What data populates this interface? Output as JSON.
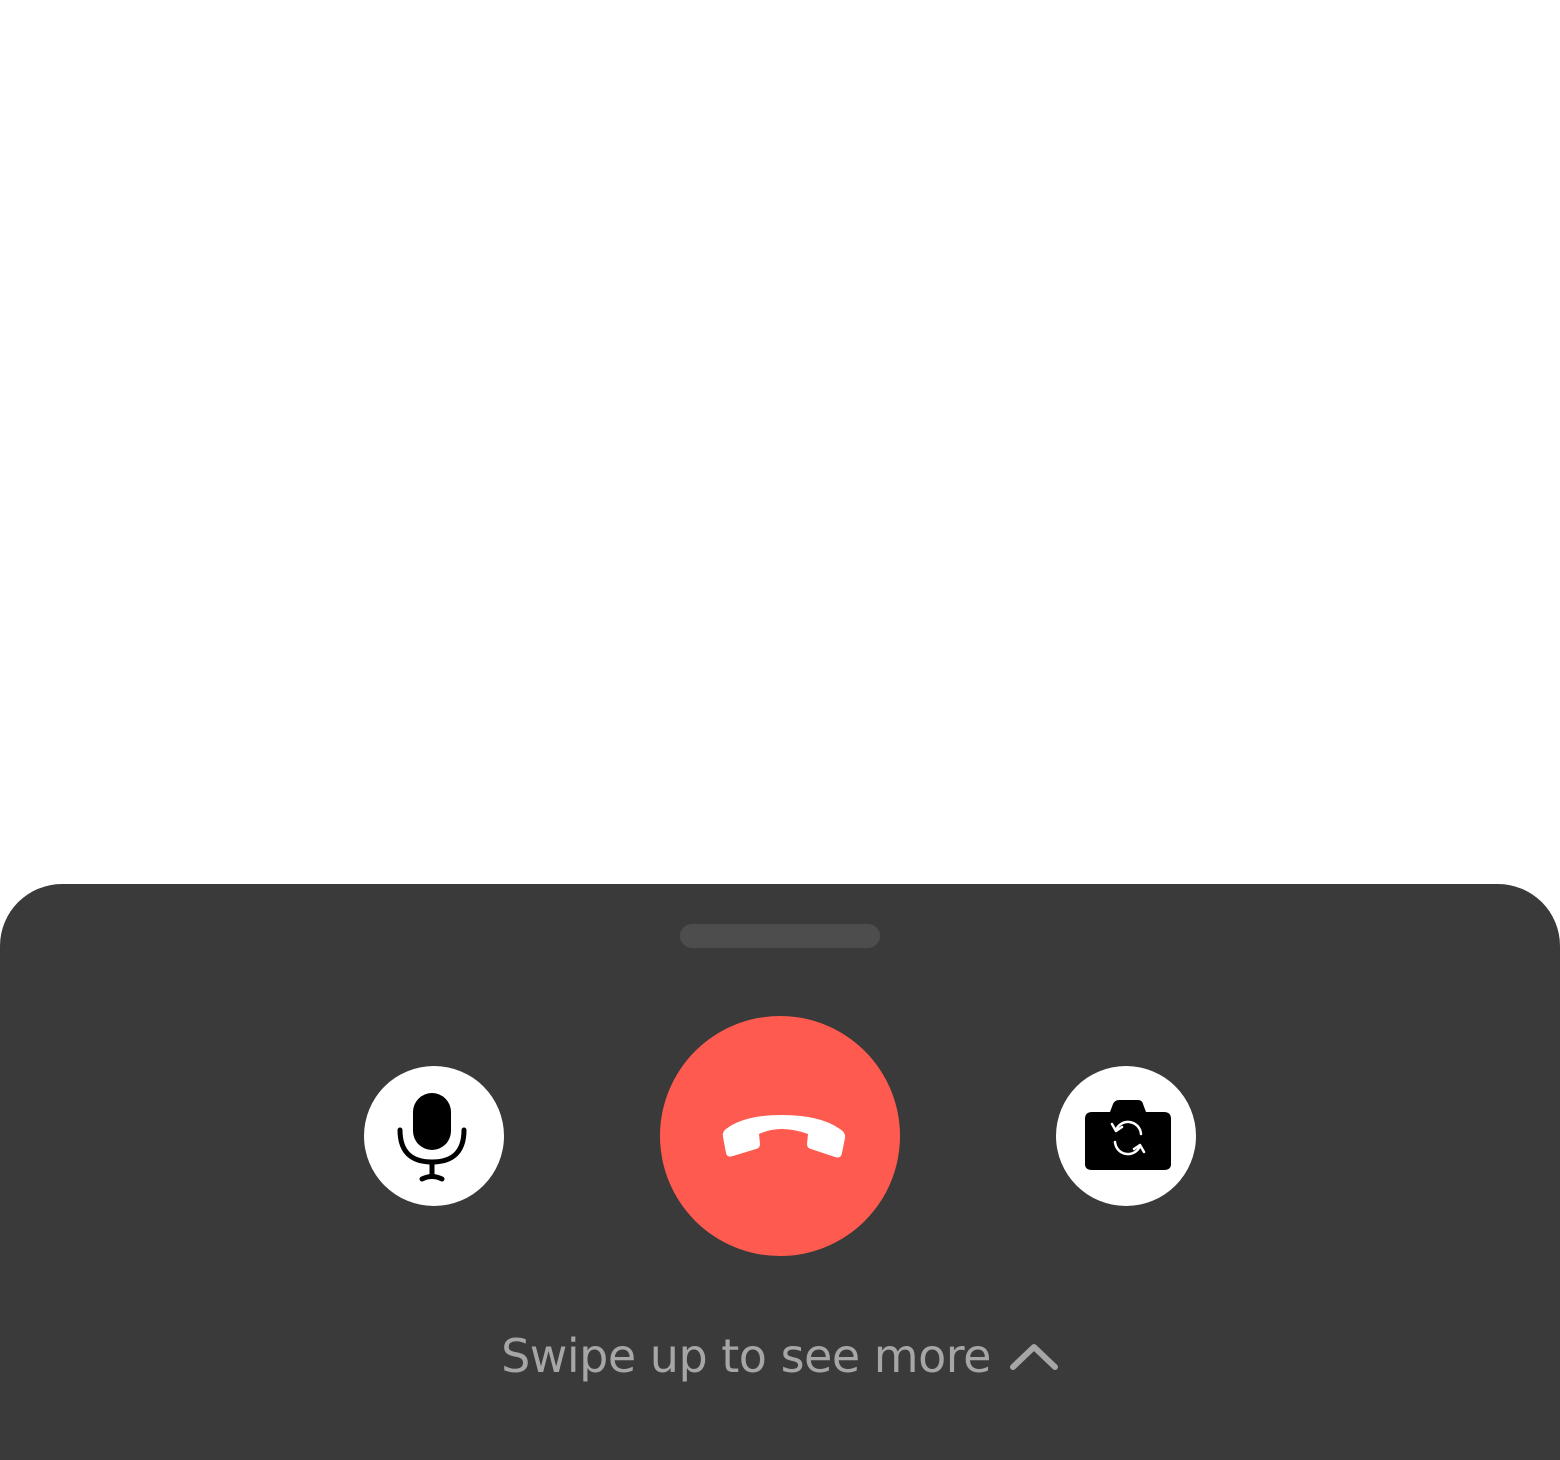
{
  "colors": {
    "sheet_background": "#3a3a3a",
    "handle": "#4d4d4d",
    "end_call": "#ff5a4f",
    "button_background": "#ffffff",
    "icon": "#000000",
    "hint_text": "#a6a6a6"
  },
  "controls": {
    "mic": {
      "icon": "microphone-icon"
    },
    "end_call": {
      "icon": "phone-hangup-icon"
    },
    "flip_camera": {
      "icon": "camera-flip-icon"
    }
  },
  "hint": {
    "text": "Swipe up to see more",
    "icon": "chevron-up-icon"
  }
}
